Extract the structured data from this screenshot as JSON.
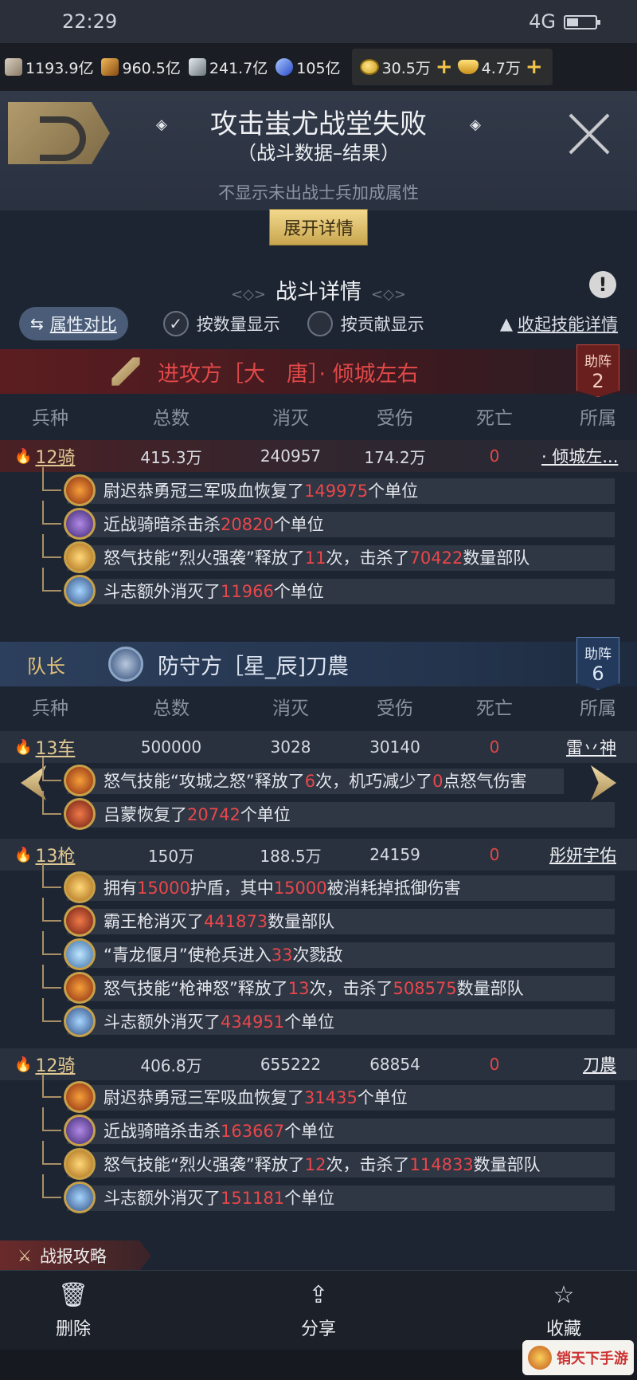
{
  "status": {
    "time": "22:29",
    "network": "4G"
  },
  "resources": [
    {
      "icon": "wood-icon",
      "value": "1193.9亿"
    },
    {
      "icon": "grain-icon",
      "value": "960.5亿"
    },
    {
      "icon": "stone-icon",
      "value": "241.7亿"
    },
    {
      "icon": "crystal-icon",
      "value": "105亿"
    }
  ],
  "currency": {
    "coins": "30.5万",
    "ingots": "4.7万"
  },
  "header": {
    "title": "攻击蚩尤战堂失败",
    "subtitle": "（战斗数据–结果）",
    "hint": "不显示未出战士兵加成属性",
    "expand_label": "展开详情",
    "section_title": "战斗详情"
  },
  "options": {
    "compare_label": "属性对比",
    "by_quantity_label": "按数量显示",
    "by_contribution_label": "按贡献显示",
    "collapse_label": "收起技能详情"
  },
  "columns": [
    "兵种",
    "总数",
    "消灭",
    "受伤",
    "死亡",
    "所属"
  ],
  "attacker": {
    "label": "进攻方［大　唐］· 倾城左右",
    "assist_label": "助阵",
    "assist_count": "2",
    "units": [
      {
        "type": "12骑",
        "total": "415.3万",
        "killed": "240957",
        "wounded": "174.2万",
        "dead": "0",
        "owner": "· 倾城左...",
        "events": [
          {
            "avatar": "fire",
            "pre": "尉迟恭勇冠三军吸血恢复了",
            "num": "149975",
            "post": "个单位"
          },
          {
            "avatar": "purple",
            "pre": "近战骑暗杀击杀",
            "num": "20820",
            "post": "个单位"
          },
          {
            "avatar": "gold",
            "pre": "怒气技能“烈火强袭”释放了",
            "num": "11",
            "mid": "次，击杀了",
            "num2": "70422",
            "post": "数量部队"
          },
          {
            "avatar": "blue",
            "pre": "斗志额外消灭了",
            "num": "11966",
            "post": "个单位"
          }
        ]
      }
    ]
  },
  "defender": {
    "captain_label": "队长",
    "label": "防守方［星_辰]刀農",
    "assist_label": "助阵",
    "assist_count": "6",
    "units": [
      {
        "type": "13车",
        "total": "500000",
        "killed": "3028",
        "wounded": "30140",
        "dead": "0",
        "owner": "雷丷神",
        "events": [
          {
            "avatar": "fire",
            "pre": "怒气技能“攻城之怒”释放了",
            "num": "6",
            "mid": "次，机巧减少了",
            "num2": "0",
            "post": "点怒气伤害"
          },
          {
            "avatar": "red",
            "pre": "吕蒙恢复了",
            "num": "20742",
            "post": "个单位"
          }
        ]
      },
      {
        "type": "13枪",
        "total": "150万",
        "killed": "188.5万",
        "wounded": "24159",
        "dead": "0",
        "owner": "彤妍宇佑",
        "events": [
          {
            "avatar": "gold",
            "pre": "拥有",
            "num": "15000",
            "mid": "护盾，其中",
            "num2": "15000",
            "post": "被消耗掉抵御伤害"
          },
          {
            "avatar": "red",
            "pre": "霸王枪消灭了",
            "num": "441873",
            "post": "数量部队"
          },
          {
            "avatar": "cyan",
            "pre": "“青龙偃月”使枪兵进入",
            "num": "33",
            "post": "次戮敌"
          },
          {
            "avatar": "fire",
            "pre": "怒气技能“枪神怒”释放了",
            "num": "13",
            "mid": "次，击杀了",
            "num2": "508575",
            "post": "数量部队"
          },
          {
            "avatar": "blue",
            "pre": "斗志额外消灭了",
            "num": "434951",
            "post": "个单位"
          }
        ]
      },
      {
        "type": "12骑",
        "total": "406.8万",
        "killed": "655222",
        "wounded": "68854",
        "dead": "0",
        "owner": "刀農",
        "events": [
          {
            "avatar": "fire",
            "pre": "尉迟恭勇冠三军吸血恢复了",
            "num": "31435",
            "post": "个单位"
          },
          {
            "avatar": "purple",
            "pre": "近战骑暗杀击杀",
            "num": "163667",
            "post": "个单位"
          },
          {
            "avatar": "gold",
            "pre": "怒气技能“烈火强袭”释放了",
            "num": "12",
            "mid": "次，击杀了",
            "num2": "114833",
            "post": "数量部队"
          },
          {
            "avatar": "blue",
            "pre": "斗志额外消灭了",
            "num": "151181",
            "post": "个单位"
          }
        ]
      }
    ]
  },
  "guide_label": "战报攻略",
  "bottom": {
    "delete_label": "删除",
    "share_label": "分享",
    "favorite_label": "收藏"
  },
  "watermark": "销天下手游"
}
